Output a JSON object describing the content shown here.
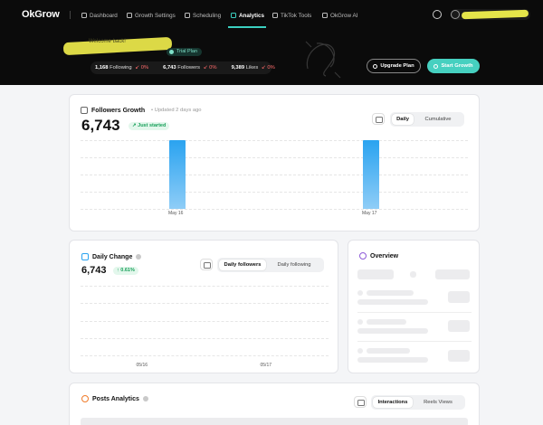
{
  "nav": {
    "logo": "OkGrow",
    "items": [
      {
        "label": "Dashboard",
        "active": false
      },
      {
        "label": "Growth Settings",
        "active": false
      },
      {
        "label": "Scheduling",
        "active": false
      },
      {
        "label": "Analytics",
        "active": true
      },
      {
        "label": "TikTok Tools",
        "active": false
      },
      {
        "label": "OkGrow AI",
        "active": false
      }
    ]
  },
  "hero": {
    "welcome": "Welcome back!",
    "plan": "Trial Plan",
    "stats": [
      {
        "value": "1,168",
        "label": "Following",
        "delta": "0%"
      },
      {
        "value": "6,743",
        "label": "Followers",
        "delta": "0%"
      },
      {
        "value": "9,389",
        "label": "Likes",
        "delta": "0%"
      }
    ],
    "upgrade_label": "Upgrade Plan",
    "start_label": "Start Growth"
  },
  "followers_growth": {
    "title": "Followers Growth",
    "updated": "Updated 2 days ago",
    "value": "6,743",
    "badge": "Just started",
    "tabs": [
      "Daily",
      "Cumulative"
    ],
    "selected_tab": "Daily"
  },
  "daily_change": {
    "title": "Daily Change",
    "value": "6,743",
    "badge": "0.61%",
    "tabs": [
      "Daily followers",
      "Daily following"
    ],
    "selected_tab": "Daily followers"
  },
  "overview": {
    "title": "Overview"
  },
  "posts_analytics": {
    "title": "Posts Analytics",
    "tabs": [
      "Interactions",
      "Reels Views"
    ],
    "selected_tab": "Interactions"
  },
  "chart_data": [
    {
      "type": "bar",
      "title": "Followers Growth",
      "categories": [
        "May 16",
        "May 17"
      ],
      "values": [
        1,
        1
      ],
      "colors": {
        "bar": "#2aa3f0"
      },
      "grid": true
    },
    {
      "type": "bar",
      "title": "Daily Change",
      "categories": [
        "05/16",
        "05/17"
      ],
      "values": [],
      "grid": true
    }
  ]
}
